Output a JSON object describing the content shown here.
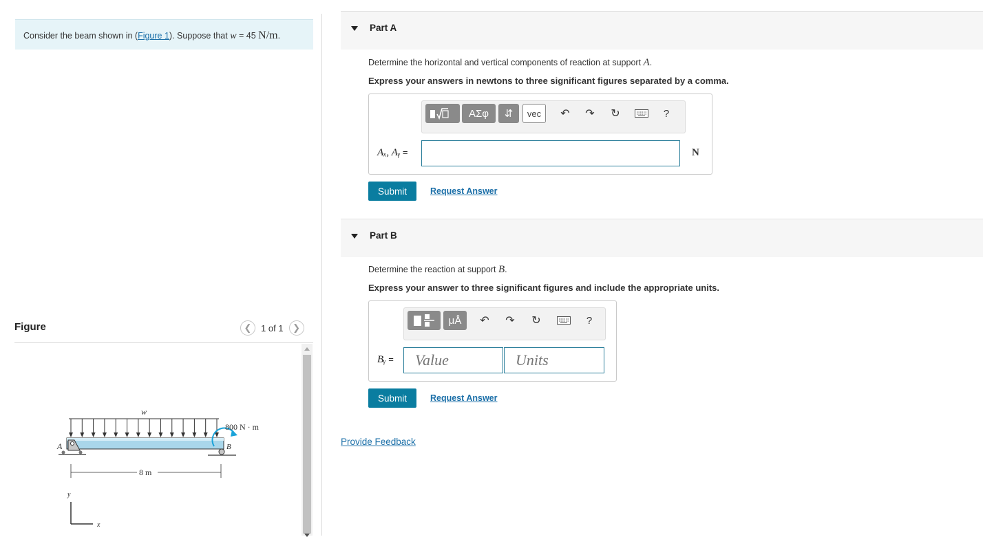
{
  "problem": {
    "prefix": "Consider the beam shown in (",
    "figure_link": "Figure 1",
    "middle": "). Suppose that ",
    "var": "w",
    "equals": " = 45 ",
    "unit": "N/m",
    "suffix": "."
  },
  "figure": {
    "title": "Figure",
    "pager": "1 of 1",
    "prev_icon": "chevron-left-icon",
    "next_icon": "chevron-right-icon",
    "labels": {
      "load": "w",
      "moment": "800 N · m",
      "support_a": "A",
      "support_b": "B",
      "span": "8 m",
      "axis_y": "y",
      "axis_x": "x"
    }
  },
  "partA": {
    "label": "Part A",
    "question_prefix": "Determine the horizontal and vertical components of reaction at support ",
    "question_var": "A",
    "question_suffix": ".",
    "instruction": "Express your answers in newtons to three significant figures separated by a comma.",
    "toolbar": {
      "templates_icon": "templates-sqrt-icon",
      "greek": "ΑΣφ",
      "arrows": "⇵",
      "vec": "vec",
      "icons": [
        "undo-icon",
        "redo-icon",
        "reset-icon",
        "keyboard-icon",
        "help-icon"
      ]
    },
    "var_label_main": "Aₓ, Aᵧ",
    "eq": " =",
    "answer_value": "",
    "unit": "N",
    "submit": "Submit",
    "request": "Request Answer"
  },
  "partB": {
    "label": "Part B",
    "question_prefix": "Determine the reaction at support ",
    "question_var": "B",
    "question_suffix": ".",
    "instruction": "Express your answer to three significant figures and include the appropriate units.",
    "toolbar": {
      "templates_icon": "templates-fraction-icon",
      "units": "μÅ",
      "icons": [
        "undo-icon",
        "redo-icon",
        "reset-icon",
        "keyboard-icon",
        "help-icon"
      ]
    },
    "var_label_main": "Bᵧ",
    "eq": " =",
    "value_placeholder": "Value",
    "units_placeholder": "Units",
    "submit": "Submit",
    "request": "Request Answer"
  },
  "feedback": "Provide Feedback",
  "help_glyph": "?",
  "colors": {
    "accent": "#0a7da0",
    "link": "#1b6fa8",
    "problem_bg": "#e6f4f8",
    "moment_arrow": "#1aa3d9",
    "beam": "#a9d6ea"
  }
}
